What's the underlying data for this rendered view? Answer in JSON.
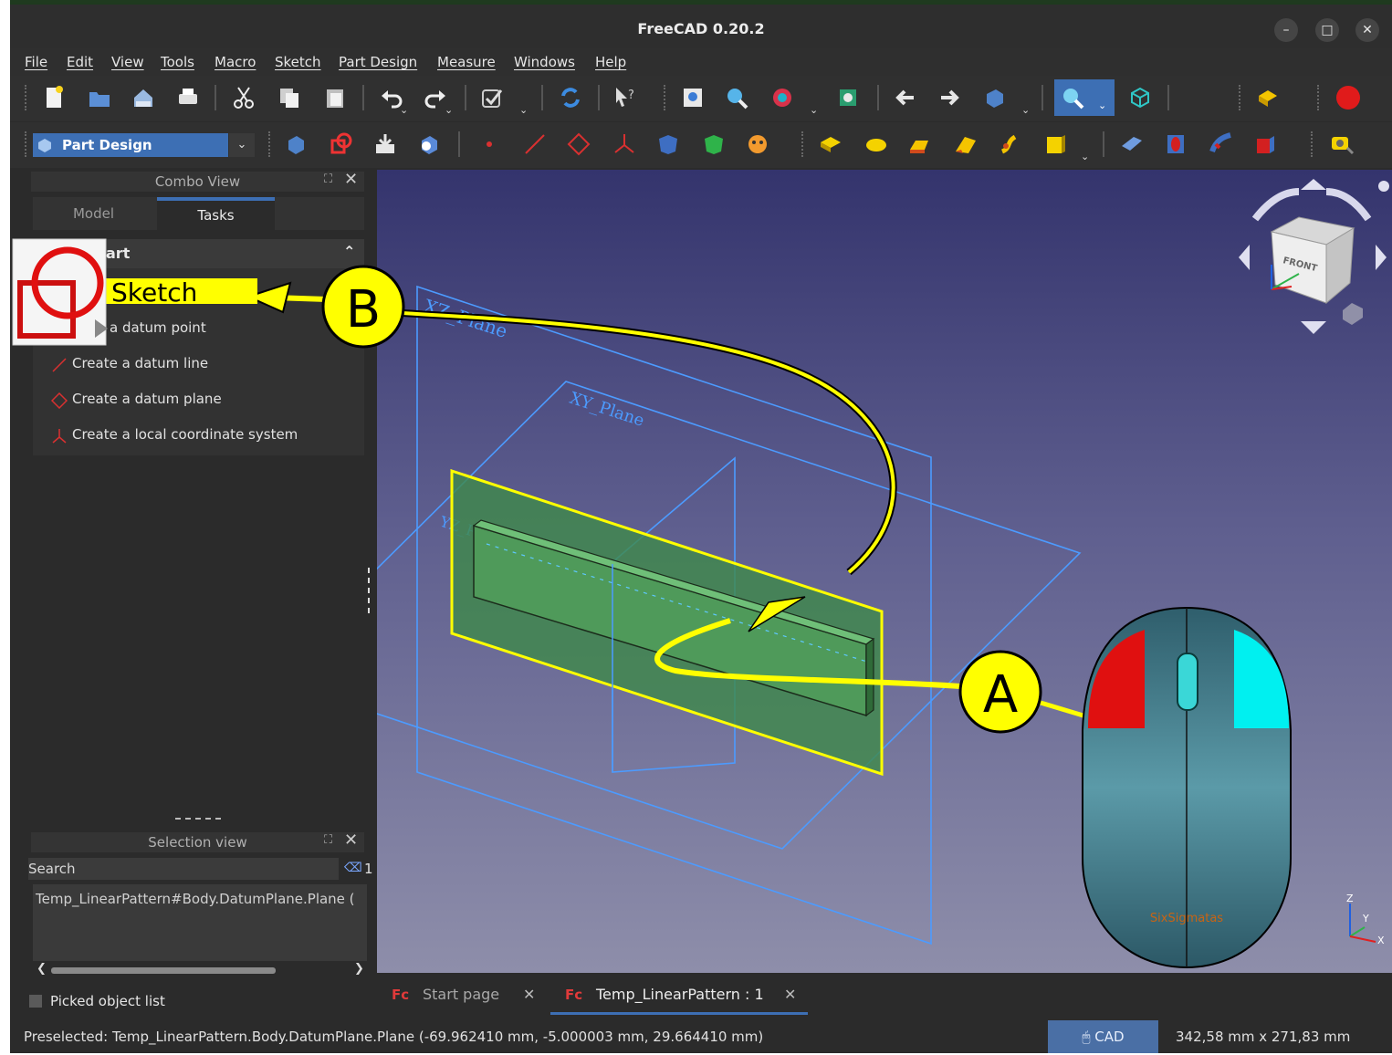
{
  "window": {
    "title": "FreeCAD 0.20.2",
    "minimize": "–",
    "maximize": "□",
    "close": "✕"
  },
  "menubar": [
    "File",
    "Edit",
    "View",
    "Tools",
    "Macro",
    "Sketch",
    "Part Design",
    "Measure",
    "Windows",
    "Help"
  ],
  "workbench": {
    "selected": "Part Design"
  },
  "combo_view": {
    "title": "Combo View",
    "tabs": [
      "Model",
      "Tasks"
    ],
    "active_tab": "Tasks",
    "task_header": "art",
    "task_items": [
      "a datum point",
      "Create a datum line",
      "Create a datum plane",
      "Create a local coordinate system"
    ]
  },
  "selection_view": {
    "title": "Selection view",
    "search_placeholder": "Search",
    "count": "1",
    "selected_item": "Temp_LinearPattern#Body.DatumPlane.Plane (",
    "picked_object_list": "Picked object list"
  },
  "viewport": {
    "plane_labels": [
      "XZ_Plane",
      "XY_Plane",
      "YZ_Plane"
    ],
    "navcube_face": "FRONT",
    "axis_labels": {
      "x": "X",
      "y": "Y",
      "z": "Z"
    },
    "mouse_brand": "SixSigmatas"
  },
  "callouts": {
    "a": "A",
    "b": "B",
    "sketch_label": "Sketch"
  },
  "doc_tabs": [
    {
      "label": "Start page",
      "active": false
    },
    {
      "label": "Temp_LinearPattern : 1",
      "active": true
    }
  ],
  "status_bar": {
    "preselected": "Preselected: Temp_LinearPattern.Body.DatumPlane.Plane (-69.962410 mm, -5.000003 mm, 29.664410 mm)",
    "navigation_style": "CAD",
    "dimensions": "342,58 mm x 271,83 mm"
  },
  "colors": {
    "accent": "#3d6fb4",
    "callout": "#ffff00",
    "record": "#e01b1b",
    "plane_outline": "#4c9bff"
  }
}
